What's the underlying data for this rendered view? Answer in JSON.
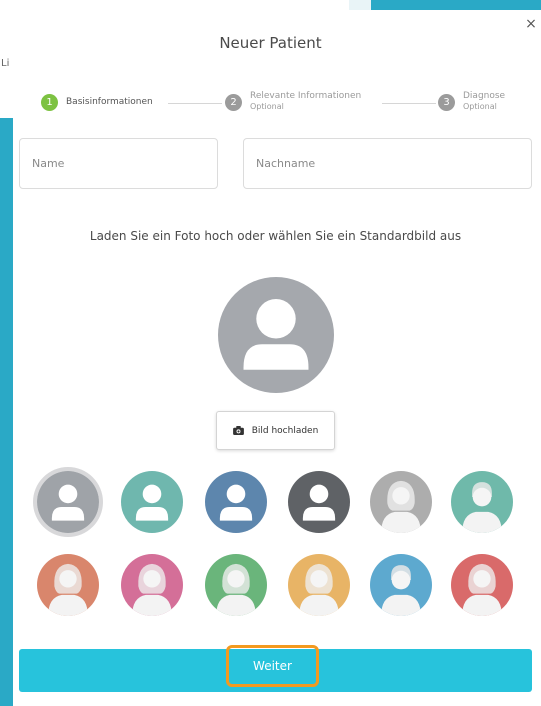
{
  "background": {
    "left_label": "Li"
  },
  "modal": {
    "title": "Neuer Patient",
    "close_glyph": "×"
  },
  "stepper": [
    {
      "number": "1",
      "label": "Basisinformationen",
      "sublabel": "",
      "state": "active"
    },
    {
      "number": "2",
      "label": "Relevante Informationen",
      "sublabel": "Optional",
      "state": "inactive"
    },
    {
      "number": "3",
      "label": "Diagnose",
      "sublabel": "Optional",
      "state": "inactive"
    }
  ],
  "form": {
    "name_placeholder": "Name",
    "lastname_placeholder": "Nachname"
  },
  "photo": {
    "instruction": "Laden Sie ein Foto hoch oder wählen Sie ein Standardbild aus",
    "upload_label": "Bild hochladen",
    "upload_icon": "camera-icon"
  },
  "avatar_options": [
    {
      "kind": "generic",
      "bg": "#9fa3a8",
      "selected": true
    },
    {
      "kind": "generic",
      "bg": "#6fb7ae",
      "selected": false
    },
    {
      "kind": "generic",
      "bg": "#5d86ad",
      "selected": false
    },
    {
      "kind": "generic",
      "bg": "#5f6266",
      "selected": false
    },
    {
      "kind": "woman",
      "bg": "#adadad",
      "selected": false
    },
    {
      "kind": "man",
      "bg": "#6fb9aa",
      "selected": false
    },
    {
      "kind": "woman",
      "bg": "#d9866c",
      "selected": false
    },
    {
      "kind": "woman",
      "bg": "#d46f98",
      "selected": false
    },
    {
      "kind": "woman",
      "bg": "#6ab57b",
      "selected": false
    },
    {
      "kind": "woman",
      "bg": "#e8b466",
      "selected": false
    },
    {
      "kind": "man",
      "bg": "#5da9cf",
      "selected": false
    },
    {
      "kind": "woman",
      "bg": "#d96a6a",
      "selected": false
    }
  ],
  "footer": {
    "continue_label": "Weiter"
  },
  "colors": {
    "accent": "#27c3dc",
    "step_active": "#7dc242",
    "step_inactive": "#9b9b9b",
    "highlight": "#f39a1f"
  }
}
